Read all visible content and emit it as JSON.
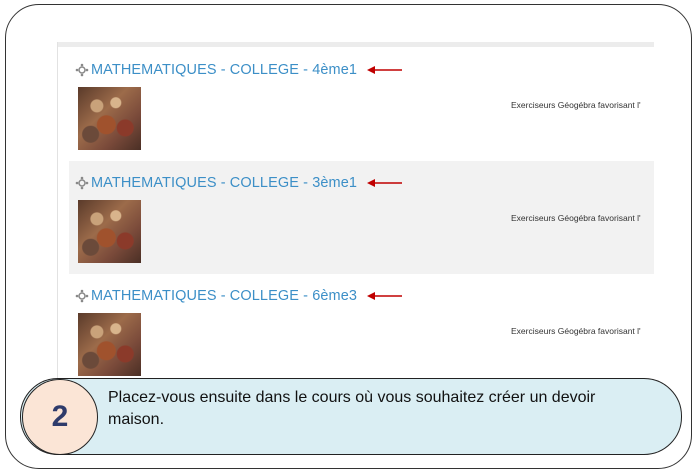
{
  "courses": [
    {
      "title": "MATHEMATIQUES - COLLEGE - 4ème1",
      "description": "Exerciseurs Géogébra favorisant l'"
    },
    {
      "title": "MATHEMATIQUES - COLLEGE - 3ème1",
      "description": "Exerciseurs Géogébra favorisant l'"
    },
    {
      "title": "MATHEMATIQUES - COLLEGE - 6ème3",
      "description": "Exerciseurs Géogébra favorisant l'"
    }
  ],
  "step": {
    "number": "2",
    "instruction": "Placez-vous ensuite dans le cours où vous souhaitez créer un devoir maison."
  },
  "colors": {
    "link": "#3c8fc7",
    "arrow": "#c00000",
    "callout_bg": "#daeef3",
    "circle_bg": "#fbe5d6",
    "number": "#2e3b6b"
  },
  "icons": {
    "course": "course-gear-icon",
    "pointer": "red-arrow-icon",
    "thumbnail": "course-image"
  }
}
